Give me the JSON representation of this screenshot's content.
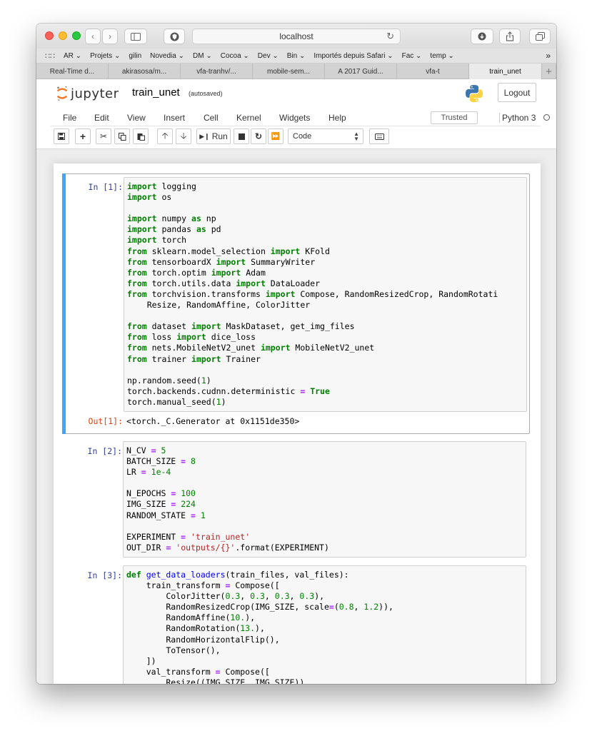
{
  "browser": {
    "url": "localhost",
    "bookmarks": [
      "AR ⌄",
      "Projets ⌄",
      "gilin",
      "Novedia ⌄",
      "DM ⌄",
      "Cocoa ⌄",
      "Dev ⌄",
      "Bin ⌄",
      "Importés depuis Safari ⌄",
      "Fac ⌄",
      "temp ⌄"
    ],
    "bookmarks_more": "»",
    "tabs": [
      "Real-Time d...",
      "akirasosa/m...",
      "vfa-tranhv/...",
      "mobile-sem...",
      "A 2017 Guid...",
      "vfa-t",
      "train_unet"
    ],
    "active_tab": 6,
    "new_tab": "+"
  },
  "header": {
    "logo_text": "jupyter",
    "notebook_name": "train_unet",
    "autosaved": "(autosaved)",
    "logout": "Logout"
  },
  "menu": {
    "items": [
      "File",
      "Edit",
      "View",
      "Insert",
      "Cell",
      "Kernel",
      "Widgets",
      "Help"
    ],
    "trusted": "Trusted",
    "kernel": "Python 3"
  },
  "toolbar": {
    "run_label": "Run",
    "cell_type": "Code"
  },
  "cells": [
    {
      "prompt": "In [1]:",
      "out_prompt": "Out[1]:",
      "output": "<torch._C.Generator at 0x1151de350>"
    },
    {
      "prompt": "In [2]:"
    },
    {
      "prompt": "In [3]:"
    }
  ],
  "code": {
    "c1": [
      "import logging",
      "import os",
      "",
      "import numpy as np",
      "import pandas as pd",
      "import torch",
      "from sklearn.model_selection import KFold",
      "from tensorboardX import SummaryWriter",
      "from torch.optim import Adam",
      "from torch.utils.data import DataLoader",
      "from torchvision.transforms import Compose, RandomResizedCrop, RandomRotati",
      "    Resize, RandomAffine, ColorJitter",
      "",
      "from dataset import MaskDataset, get_img_files",
      "from loss import dice_loss",
      "from nets.MobileNetV2_unet import MobileNetV2_unet",
      "from trainer import Trainer",
      "",
      "np.random.seed(1)",
      "torch.backends.cudnn.deterministic = True",
      "torch.manual_seed(1)"
    ],
    "c2": [
      "N_CV = 5",
      "BATCH_SIZE = 8",
      "LR = 1e-4",
      "",
      "N_EPOCHS = 100",
      "IMG_SIZE = 224",
      "RANDOM_STATE = 1",
      "",
      "EXPERIMENT = 'train_unet'",
      "OUT_DIR = 'outputs/{}'.format(EXPERIMENT)"
    ],
    "c3": [
      "def get_data_loaders(train_files, val_files):",
      "    train_transform = Compose([",
      "        ColorJitter(0.3, 0.3, 0.3, 0.3),",
      "        RandomResizedCrop(IMG_SIZE, scale=(0.8, 1.2)),",
      "        RandomAffine(10.),",
      "        RandomRotation(13.),",
      "        RandomHorizontalFlip(),",
      "        ToTensor(),",
      "    ])",
      "    val_transform = Compose([",
      "        Resize((IMG_SIZE, IMG_SIZE)),"
    ]
  }
}
